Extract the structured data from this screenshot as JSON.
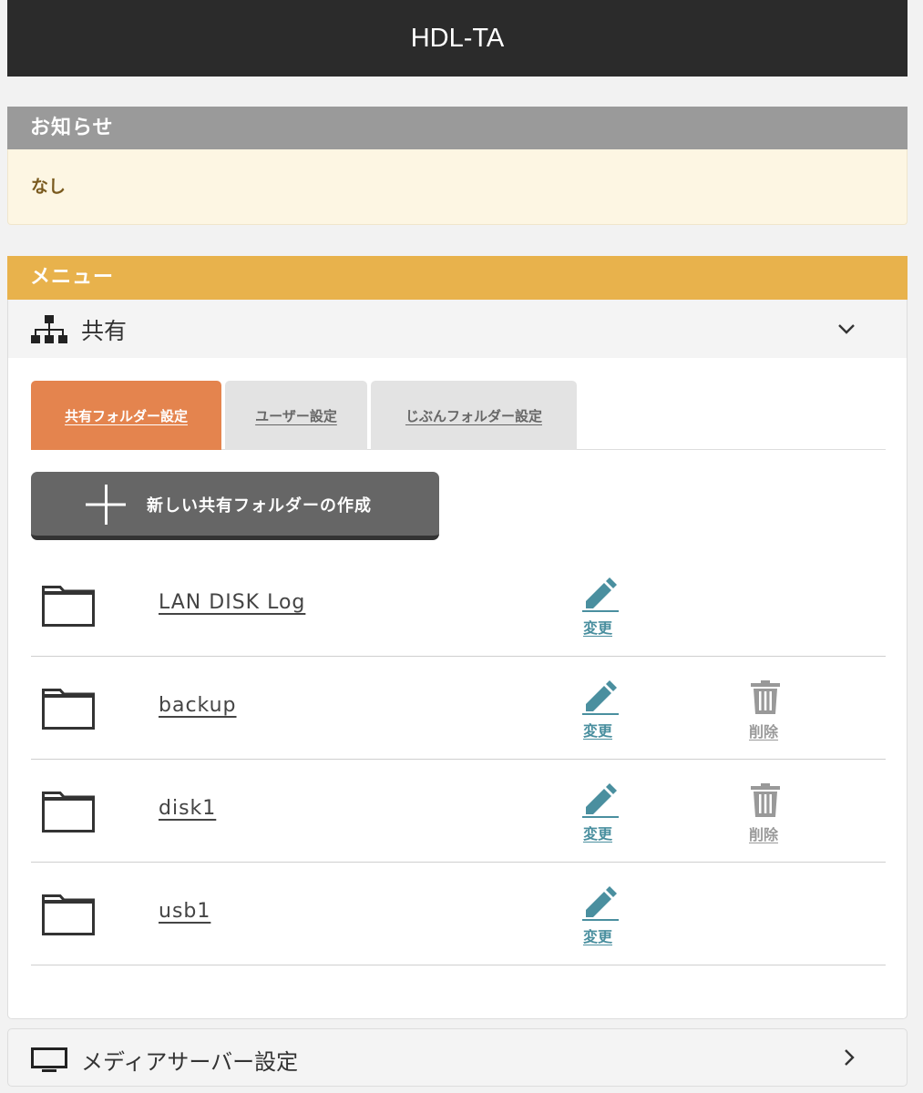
{
  "header": {
    "title": "HDL-TA"
  },
  "notice": {
    "heading": "お知らせ",
    "body": "なし"
  },
  "menu": {
    "heading": "メニュー"
  },
  "share": {
    "title": "共有",
    "tabs": [
      {
        "label": "共有フォルダー設定"
      },
      {
        "label": "ユーザー設定"
      },
      {
        "label": "じぶんフォルダー設定"
      }
    ],
    "create_label": "新しい共有フォルダーの作成",
    "edit_label": "変更",
    "delete_label": "削除",
    "folders": [
      {
        "name": "LAN DISK Log"
      },
      {
        "name": "backup"
      },
      {
        "name": "disk1"
      },
      {
        "name": "usb1"
      }
    ]
  },
  "media": {
    "title": "メディアサーバー設定"
  },
  "colors": {
    "accent_orange": "#e4844e",
    "menu_yellow": "#e8b24c",
    "edit_teal": "#4a8f9f"
  }
}
